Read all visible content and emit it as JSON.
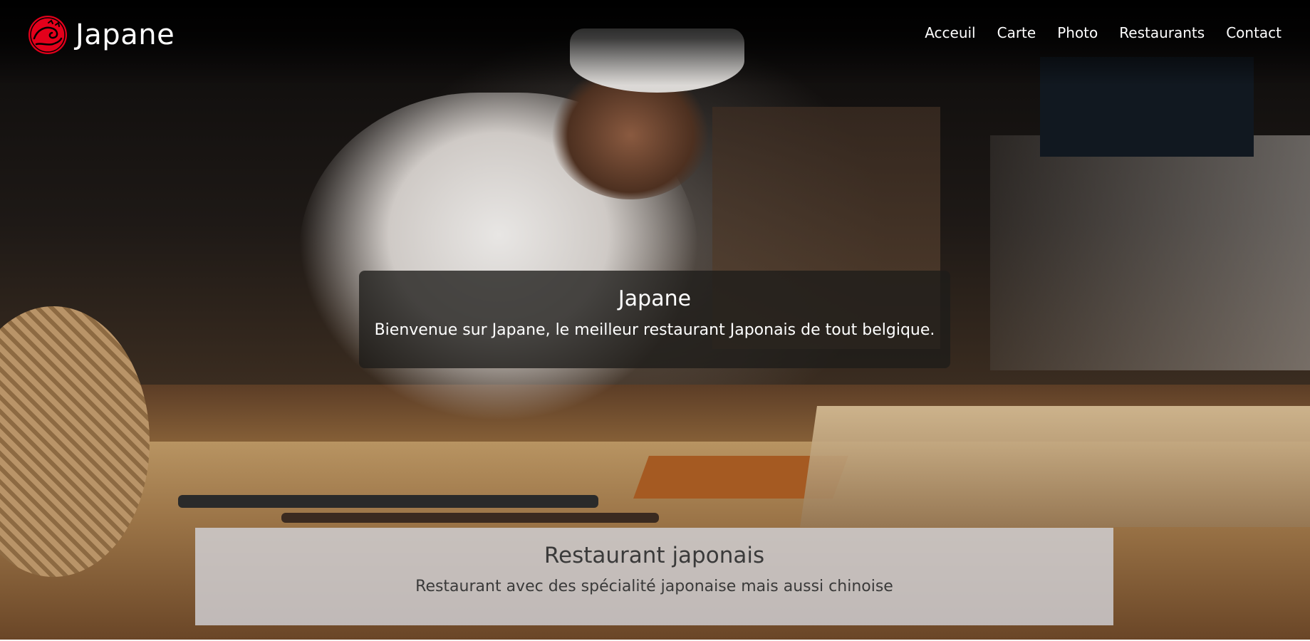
{
  "brand": {
    "name": "Japane",
    "logo_icon": "japane-wave-logo-icon",
    "logo_color": "#e3001b"
  },
  "nav": {
    "items": [
      {
        "label": "Acceuil"
      },
      {
        "label": "Carte"
      },
      {
        "label": "Photo"
      },
      {
        "label": "Restaurants"
      },
      {
        "label": "Contact"
      }
    ]
  },
  "hero": {
    "background_image": "sushi-chef-kitchen-photo",
    "welcome": {
      "title": "Japane",
      "text": "Bienvenue sur Japane, le meilleur restaurant Japonais de tout belgique."
    },
    "info": {
      "title": "Restaurant japonais",
      "text": "Restaurant avec des spécialité japonaise mais aussi chinoise"
    }
  }
}
